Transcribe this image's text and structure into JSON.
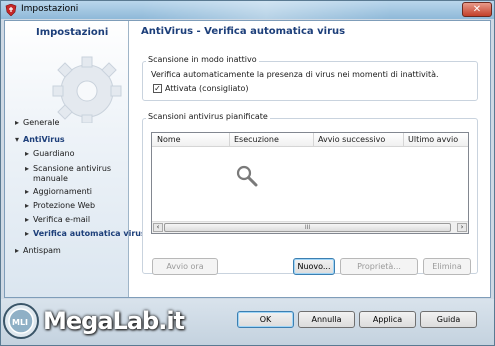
{
  "window": {
    "title": "Impostazioni"
  },
  "nav": {
    "header": "Impostazioni",
    "items": [
      {
        "label": "Generale",
        "arrow": "▸"
      },
      {
        "label": "AntiVirus",
        "arrow": "▾"
      },
      {
        "label": "Guardiano",
        "arrow": "▸"
      },
      {
        "label": "Scansione antivirus manuale",
        "arrow": "▸"
      },
      {
        "label": "Aggiornamenti",
        "arrow": "▸"
      },
      {
        "label": "Protezione Web",
        "arrow": "▸"
      },
      {
        "label": "Verifica e-mail",
        "arrow": "▸"
      },
      {
        "label": "Verifica automatica virus",
        "arrow": "▸"
      },
      {
        "label": "Antispam",
        "arrow": "▸"
      }
    ]
  },
  "main": {
    "title": "AntiVirus - Verifica automatica virus",
    "idle_group": {
      "label": "Scansione in modo inattivo",
      "description": "Verifica automaticamente la presenza di virus nei momenti di inattività.",
      "checkbox_label": "Attivata (consigliato)",
      "checked": true
    },
    "scheduled_group": {
      "label": "Scansioni antivirus pianificate",
      "columns": [
        "Nome",
        "Esecuzione",
        "Avvio successivo",
        "Ultimo avvio"
      ],
      "scroll_thumb": "III"
    },
    "actions": {
      "run_now": "Avvio ora",
      "new": "Nuovo...",
      "properties": "Proprietà...",
      "delete": "Elimina"
    }
  },
  "footer": {
    "ok": "OK",
    "cancel": "Annulla",
    "apply": "Applica",
    "help": "Guida"
  },
  "watermark": {
    "text": "MegaLab.it",
    "badge": "MLI"
  },
  "colors": {
    "accent": "#1d3f7a",
    "close": "#c3402a"
  }
}
